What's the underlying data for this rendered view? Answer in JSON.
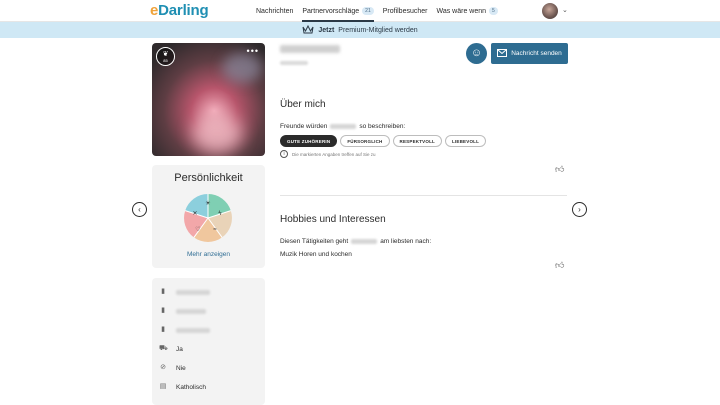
{
  "brand": {
    "logo_text": "Darling",
    "logo_prefix": "e"
  },
  "nav": {
    "items": [
      {
        "label": "Nachrichten",
        "badge": ""
      },
      {
        "label": "Partnervorschläge",
        "badge": "21"
      },
      {
        "label": "Profilbesucher",
        "badge": ""
      },
      {
        "label": "Was wäre wenn",
        "badge": "5"
      }
    ]
  },
  "premium": {
    "bold": "Jetzt",
    "text": "Premium-Mitglied werden"
  },
  "profile": {
    "score": "85",
    "personality_title": "Persönlichkeit",
    "more_link": "Mehr anzeigen",
    "pie_colors": [
      "#7fcfb3",
      "#e9d3b8",
      "#f0c79e",
      "#f2a7a9",
      "#8ccfdd"
    ],
    "facts": [
      {
        "icon": "ruler-icon",
        "value": ""
      },
      {
        "icon": "person-icon",
        "value": ""
      },
      {
        "icon": "building-icon",
        "value": ""
      },
      {
        "icon": "kids-icon",
        "value": "Ja"
      },
      {
        "icon": "smoking-icon",
        "value": "Nie"
      },
      {
        "icon": "religion-icon",
        "value": "Katholisch"
      }
    ]
  },
  "actions": {
    "message_label": "Nachricht senden"
  },
  "about": {
    "title": "Über mich",
    "friends_prefix": "Freunde würden",
    "friends_suffix": "so beschreiben:",
    "tags": [
      "GUTE ZUHÖRERIN",
      "FÜRSORGLICH",
      "RESPEKTVOLL",
      "LIEBEVOLL"
    ],
    "info_note": "Die markierten Angaben treffen auf Sie zu"
  },
  "hobbies": {
    "title": "Hobbies und Interessen",
    "activity_prefix": "Diesen Tätigkeiten geht",
    "activity_suffix": "am liebsten nach:",
    "value": "Muzik Horen und kochen"
  },
  "colors": {
    "accent": "#2e6c91",
    "premium_bar": "#cfe8f5",
    "dark_tag": "#2b2b2b"
  }
}
